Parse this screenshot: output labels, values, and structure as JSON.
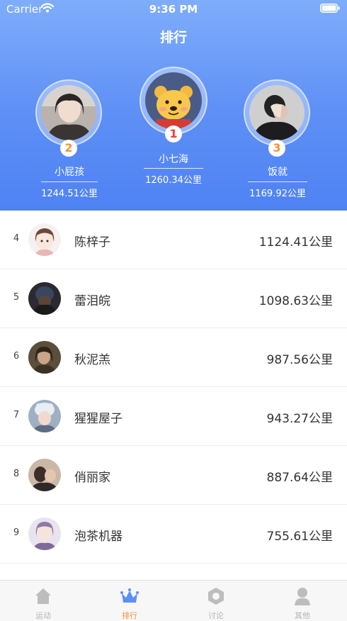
{
  "status_bar": {
    "carrier": "Carrier",
    "time": "9:36 PM"
  },
  "header": {
    "title": "排行"
  },
  "podium": [
    {
      "rank": "2",
      "name": "小屁孩",
      "distance": "1244.51公里",
      "badge_color": "#f0943a"
    },
    {
      "rank": "1",
      "name": "小七海",
      "distance": "1260.34公里",
      "badge_color": "#e8423b"
    },
    {
      "rank": "3",
      "name": "饭就",
      "distance": "1169.92公里",
      "badge_color": "#f0943a"
    }
  ],
  "ranking": [
    {
      "rank": "4",
      "name": "陈梓子",
      "distance": "1124.41公里"
    },
    {
      "rank": "5",
      "name": "蕾泪皖",
      "distance": "1098.63公里"
    },
    {
      "rank": "6",
      "name": "秋泥羔",
      "distance": "987.56公里"
    },
    {
      "rank": "7",
      "name": "猩猩屋子",
      "distance": "943.27公里"
    },
    {
      "rank": "8",
      "name": "俏丽家",
      "distance": "887.64公里"
    },
    {
      "rank": "9",
      "name": "泡茶机器",
      "distance": "755.61公里"
    }
  ],
  "tabbar": {
    "tabs": [
      {
        "label": "运动",
        "icon": "house-icon",
        "active": false
      },
      {
        "label": "排行",
        "icon": "crown-icon",
        "active": true
      },
      {
        "label": "讨论",
        "icon": "hexagon-icon",
        "active": false
      },
      {
        "label": "其他",
        "icon": "person-icon",
        "active": false
      }
    ]
  },
  "colors": {
    "header_top": "#7fadfb",
    "header_bottom": "#4f82f4",
    "accent": "#f0943a",
    "first_place": "#e8423b"
  }
}
